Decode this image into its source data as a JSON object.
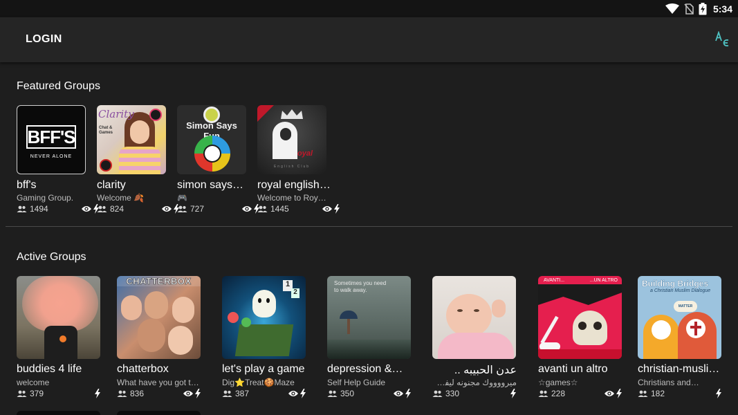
{
  "status": {
    "time": "5:34"
  },
  "appbar": {
    "login_label": "LOGIN"
  },
  "featured": {
    "title": "Featured Groups",
    "groups": [
      {
        "name": "bff's",
        "desc": "Gaming Group.",
        "members": "1494",
        "badge_text": "BFF'S",
        "badge_sub": "NEVER ALONE"
      },
      {
        "name": "clarity",
        "desc": "Welcome 🍂",
        "members": "824",
        "badge_text": "Clarity",
        "badge_sub": "Chat & Games"
      },
      {
        "name": "simon says…",
        "desc": "🎮",
        "members": "727",
        "badge_text": "Simon Says Fun"
      },
      {
        "name": "royal english…",
        "desc": "Welcome to Roy…",
        "members": "1445",
        "badge_text": "oyal",
        "badge_sub": "English Club"
      }
    ]
  },
  "active": {
    "title": "Active Groups",
    "groups": [
      {
        "name": "buddies 4 life",
        "desc": "welcome",
        "members": "379"
      },
      {
        "name": "chatterbox",
        "desc": "What have you got to…",
        "members": "836",
        "badge_text": "CHATTERBOX"
      },
      {
        "name": "let's play a game",
        "desc": "Dig⭐Treat🍪Maze",
        "members": "387"
      },
      {
        "name": "depression &…",
        "desc": "Self Help Guide",
        "members": "350",
        "badge_text": "Sometimes you need to walk away."
      },
      {
        "name": "عدن الحبيبه ..",
        "desc": "ميرووووك مجنونه ليفل 13…",
        "members": "330"
      },
      {
        "name": "avanti un altro",
        "desc": "☆games☆",
        "members": "228",
        "badge_text": "AVANTI...",
        "badge_sub": "...UN ALTRO"
      },
      {
        "name": "christian-musli…",
        "desc": "Christians and…",
        "members": "182",
        "badge_text": "Building Bridges",
        "badge_sub": "a Christian Muslim Dialogue"
      }
    ]
  },
  "colors": {
    "background": "#1e1e1e",
    "appbar": "#252525",
    "accent": "#4fc3c3"
  }
}
